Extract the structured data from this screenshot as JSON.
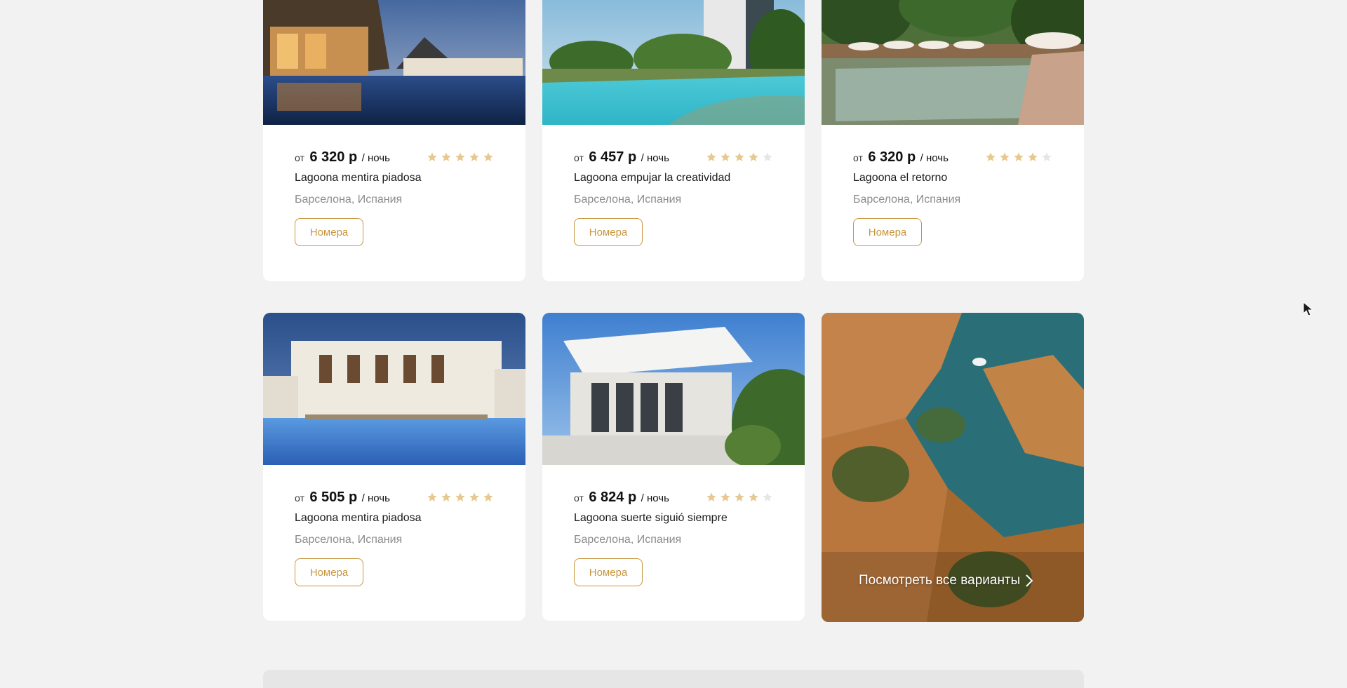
{
  "hotels": [
    {
      "price_prefix": "от",
      "price": "6 320 р",
      "price_suffix": "/ ночь",
      "rating": 5,
      "name": "Lagoona mentira piadosa",
      "location": "Барселона, Испания",
      "button": "Номера"
    },
    {
      "price_prefix": "от",
      "price": "6 457 р",
      "price_suffix": "/ ночь",
      "rating": 4,
      "name": "Lagoona empujar la creatividad",
      "location": "Барселона, Испания",
      "button": "Номера"
    },
    {
      "price_prefix": "от",
      "price": "6 320 р",
      "price_suffix": "/ ночь",
      "rating": 4,
      "name": "Lagoona el retorno",
      "location": "Барселона, Испания",
      "button": "Номера"
    },
    {
      "price_prefix": "от",
      "price": "6 505 р",
      "price_suffix": "/ ночь",
      "rating": 5,
      "name": "Lagoona mentira piadosa",
      "location": "Барселона, Испания",
      "button": "Номера"
    },
    {
      "price_prefix": "от",
      "price": "6 824 р",
      "price_suffix": "/ ночь",
      "rating": 4,
      "name": "Lagoona suerte siguió siempre",
      "location": "Барселона, Испания",
      "button": "Номера"
    }
  ],
  "rating_max": 5,
  "promo": {
    "label": "Посмотреть все варианты",
    "icon": "chevron-right-icon"
  },
  "colors": {
    "accent": "#c8963e",
    "star_filled": "#e7c98f",
    "star_empty": "#e6e6e6",
    "background": "#f2f2f2"
  }
}
